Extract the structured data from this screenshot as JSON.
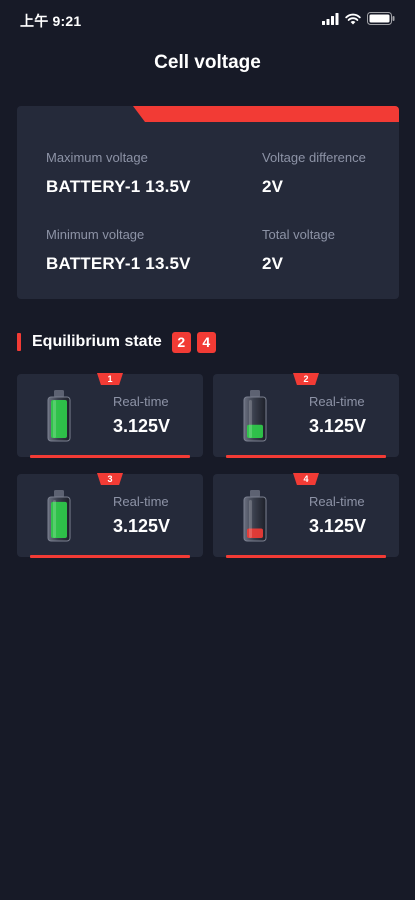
{
  "status_bar": {
    "time": "上午 9:21",
    "icons": [
      "signal-icon",
      "wifi-icon",
      "battery-icon"
    ]
  },
  "page": {
    "title": "Cell voltage"
  },
  "summary": {
    "max_voltage_label": "Maximum voltage",
    "max_voltage_value": "BATTERY-1 13.5V",
    "voltage_diff_label": "Voltage difference",
    "voltage_diff_value": "2V",
    "min_voltage_label": "Minimum voltage",
    "min_voltage_value": "BATTERY-1 13.5V",
    "total_voltage_label": "Total voltage",
    "total_voltage_value": "2V"
  },
  "equilibrium": {
    "title": "Equilibrium state",
    "badges": [
      "2",
      "4"
    ]
  },
  "cells": [
    {
      "number": "1",
      "label": "Real-time",
      "voltage": "3.125V",
      "battery_level": 1.0,
      "battery_color": "#2fcf4a"
    },
    {
      "number": "2",
      "label": "Real-time",
      "voltage": "3.125V",
      "battery_level": 0.35,
      "battery_color": "#2fcf4a"
    },
    {
      "number": "3",
      "label": "Real-time",
      "voltage": "3.125V",
      "battery_level": 0.95,
      "battery_color": "#2fcf4a"
    },
    {
      "number": "4",
      "label": "Real-time",
      "voltage": "3.125V",
      "battery_level": 0.25,
      "battery_color": "#f23b35"
    }
  ],
  "colors": {
    "background": "#171a27",
    "card": "#252a3a",
    "accent": "#f23b35",
    "muted_text": "#8d93a6"
  }
}
